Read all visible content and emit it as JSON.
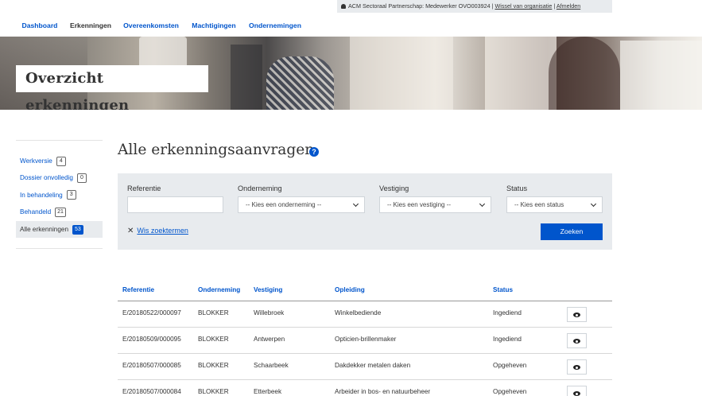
{
  "userbar": {
    "user_text": "ACM Sectoraal Partnerschap: Medewerker OVO003924 |",
    "switch_org": "Wissel van organisatie",
    "separator": "|",
    "logout": "Afmelden"
  },
  "nav": {
    "tabs": [
      {
        "label": "Dashboard"
      },
      {
        "label": "Erkenningen",
        "active": true
      },
      {
        "label": "Overeenkomsten"
      },
      {
        "label": "Machtigingen"
      },
      {
        "label": "Ondernemingen"
      }
    ]
  },
  "hero": {
    "title": "Overzicht erkenningen"
  },
  "sidebar": {
    "items": [
      {
        "label": "Werkversie",
        "count": "4"
      },
      {
        "label": "Dossier onvolledig",
        "count": "0"
      },
      {
        "label": "In behandeling",
        "count": "3"
      },
      {
        "label": "Behandeld",
        "count": "21"
      },
      {
        "label": "Alle erkenningen",
        "count": "53",
        "active": true
      }
    ]
  },
  "main": {
    "title": "Alle erkenningsaanvragen",
    "help_icon": "?"
  },
  "filters": {
    "referentie_label": "Referentie",
    "referentie_value": "",
    "onderneming_label": "Onderneming",
    "onderneming_value": "-- Kies een onderneming --",
    "vestiging_label": "Vestiging",
    "vestiging_value": "-- Kies een vestiging --",
    "status_label": "Status",
    "status_value": "-- Kies een status",
    "clear_icon": "✕",
    "clear_label": "Wis zoektermen",
    "search_button": "Zoeken"
  },
  "table": {
    "headers": [
      "Referentie",
      "Onderneming",
      "Vestiging",
      "Opleiding",
      "Status"
    ],
    "rows": [
      [
        "E/20180522/000097",
        "BLOKKER",
        "Willebroek",
        "Winkelbediende",
        "Ingediend"
      ],
      [
        "E/20180509/000095",
        "BLOKKER",
        "Antwerpen",
        "Opticien-brillenmaker",
        "Ingediend"
      ],
      [
        "E/20180507/000085",
        "BLOKKER",
        "Schaarbeek",
        "Dakdekker metalen daken",
        "Opgeheven"
      ],
      [
        "E/20180507/000084",
        "BLOKKER",
        "Etterbeek",
        "Arbeider in bos- en natuurbeheer",
        "Opgeheven"
      ]
    ],
    "view_icon": "eye-icon"
  },
  "colors": {
    "accent": "#0055cc",
    "panel": "#e8ebee"
  }
}
